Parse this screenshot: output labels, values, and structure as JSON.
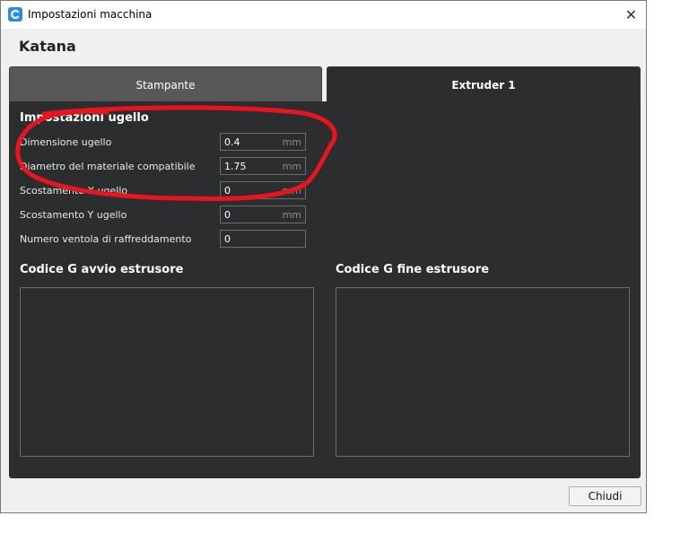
{
  "window": {
    "title": "Impostazioni macchina"
  },
  "machine": {
    "name": "Katana"
  },
  "tabs": [
    {
      "label": "Stampante",
      "active": false
    },
    {
      "label": "Extruder 1",
      "active": true
    }
  ],
  "extruder": {
    "section_title": "Impostazioni ugello",
    "fields": [
      {
        "label": "Dimensione ugello",
        "value": "0.4",
        "unit": "mm"
      },
      {
        "label": "Diametro del materiale compatibile",
        "value": "1.75",
        "unit": "mm"
      },
      {
        "label": "Scostamento X ugello",
        "value": "0",
        "unit": "mm"
      },
      {
        "label": "Scostamento Y ugello",
        "value": "0",
        "unit": "mm"
      },
      {
        "label": "Numero ventola di raffreddamento",
        "value": "0",
        "unit": ""
      }
    ],
    "gcode_start_title": "Codice G avvio estrusore",
    "gcode_end_title": "Codice G fine estrusore"
  },
  "footer": {
    "close_label": "Chiudi"
  },
  "colors": {
    "panel_bg": "#2b2d2f",
    "annotation": "#e8141e",
    "app_icon": "#2b8ce6"
  }
}
